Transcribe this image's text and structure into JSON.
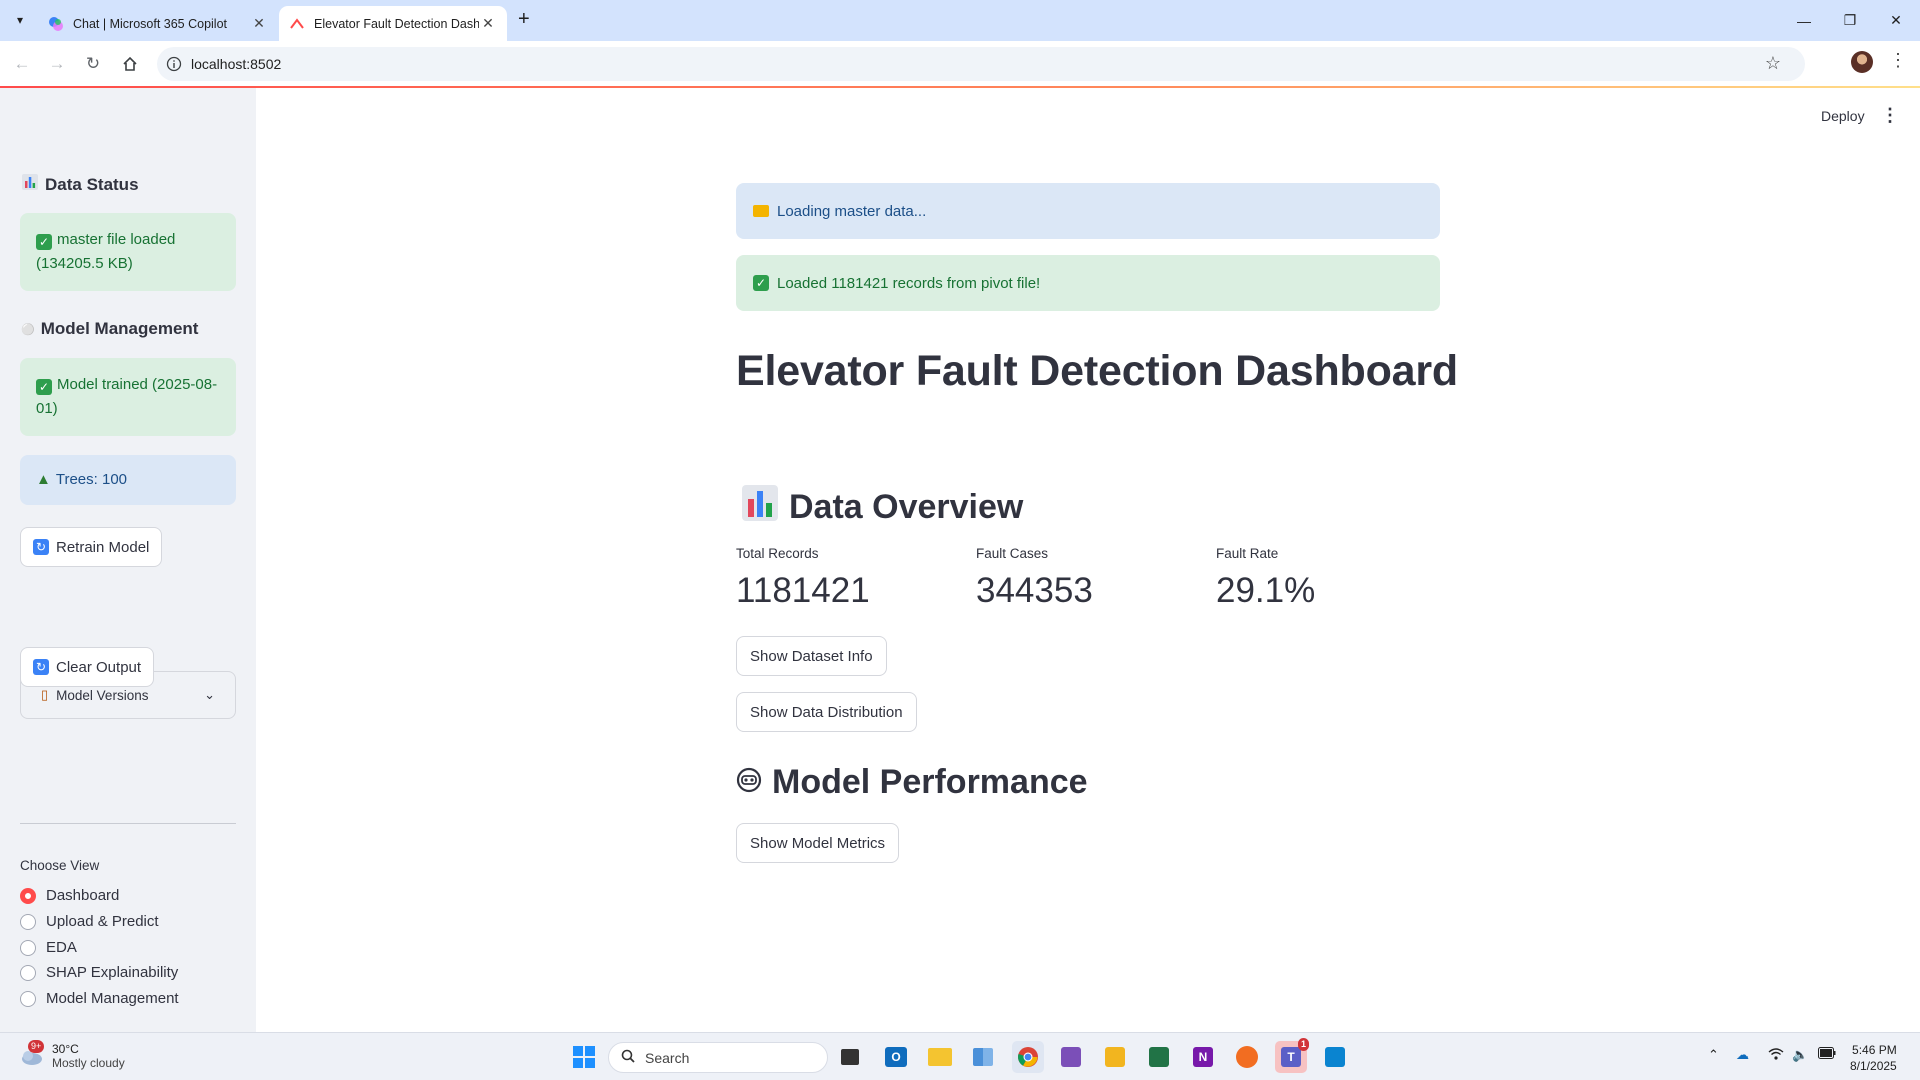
{
  "browser": {
    "tabs": [
      {
        "title": "Chat | Microsoft 365 Copilot",
        "icon": "copilot-icon"
      },
      {
        "title": "Elevator Fault Detection Dashbo",
        "icon": "streamlit-icon"
      }
    ],
    "url": "localhost:8502"
  },
  "app": {
    "deploy_label": "Deploy",
    "sidebar": {
      "data_status_heading": "Data Status",
      "data_status_msg": "master file loaded (134205.5 KB)",
      "model_mgmt_heading": "Model Management",
      "model_trained_msg": "Model trained (2025-08-01)",
      "trees_msg": "Trees: 100",
      "retrain_label": "Retrain Model",
      "versions_label": "Model Versions",
      "clear_label": "Clear Output",
      "choose_view_label": "Choose View",
      "views": [
        "Dashboard",
        "Upload & Predict",
        "EDA",
        "SHAP Explainability",
        "Model Management"
      ],
      "selected_view": "Dashboard"
    },
    "main": {
      "loading_msg": "Loading master data...",
      "loaded_msg": "Loaded 1181421 records from pivot file!",
      "title": "Elevator Fault Detection Dashboard",
      "data_overview_heading": "Data Overview",
      "metrics": [
        {
          "label": "Total Records",
          "value": "1181421"
        },
        {
          "label": "Fault Cases",
          "value": "344353"
        },
        {
          "label": "Fault Rate",
          "value": "29.1%"
        }
      ],
      "show_dataset_info": "Show Dataset Info",
      "show_data_distribution": "Show Data Distribution",
      "model_performance_heading": "Model Performance",
      "show_model_metrics": "Show Model Metrics"
    }
  },
  "taskbar": {
    "weather_temp": "30°C",
    "weather_cond": "Mostly cloudy",
    "weather_badge": "9+",
    "search_placeholder": "Search",
    "time": "5:46 PM",
    "date": "8/1/2025",
    "teams_badge": "1"
  },
  "colors": {
    "accent": "#ff4b4b",
    "success_bg": "#dbefe1",
    "success_text": "#177233",
    "info_bg": "#dbe7f6",
    "info_text": "#1c4f88",
    "sidebar_bg": "#f0f2f6"
  }
}
